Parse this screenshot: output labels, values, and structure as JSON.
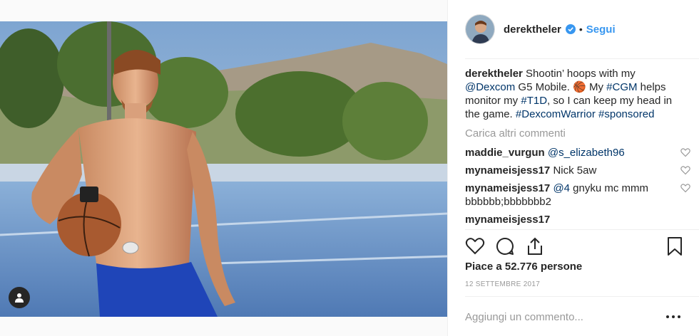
{
  "post": {
    "username": "derektheler",
    "follow_label": "Segui",
    "dot": "•",
    "caption": {
      "username": "derektheler",
      "part1": "Shootin’ hoops with my ",
      "mention": "@Dexcom",
      "part2": " G5 Mobile. ",
      "emoji": "🏀",
      "part3": " My ",
      "tag1": "#CGM",
      "part4": " helps monitor my ",
      "tag2": "#T1D",
      "part5": ", so I can keep my head in the game. ",
      "tag3": "#DexcomWarrior",
      "part6": " ",
      "tag4": "#sponsored"
    },
    "load_more": "Carica altri commenti",
    "comments": [
      {
        "username": "maddie_vurgun",
        "mention": "@s_elizabeth96",
        "text": ""
      },
      {
        "username": "mynameisjess17",
        "mention": "",
        "text": "Nick 5aw"
      },
      {
        "username": "mynameisjess17",
        "mention": "@4",
        "text": " gnyku mc mmm bbbbbb;bbbbbbb2"
      },
      {
        "username": "mynameisjess17",
        "mention": "",
        "text": ""
      }
    ],
    "likes": "Piace a 52.776 persone",
    "date": "12 SETTEMBRE 2017",
    "comment_placeholder": "Aggiungi un commento..."
  },
  "colors": {
    "accent": "#3897f0",
    "link": "#003569",
    "muted": "#999999",
    "text": "#262626"
  },
  "icons": [
    "user-tag-icon",
    "verified-badge-icon",
    "heart-icon",
    "comment-icon",
    "share-icon",
    "bookmark-icon",
    "more-options-icon"
  ]
}
